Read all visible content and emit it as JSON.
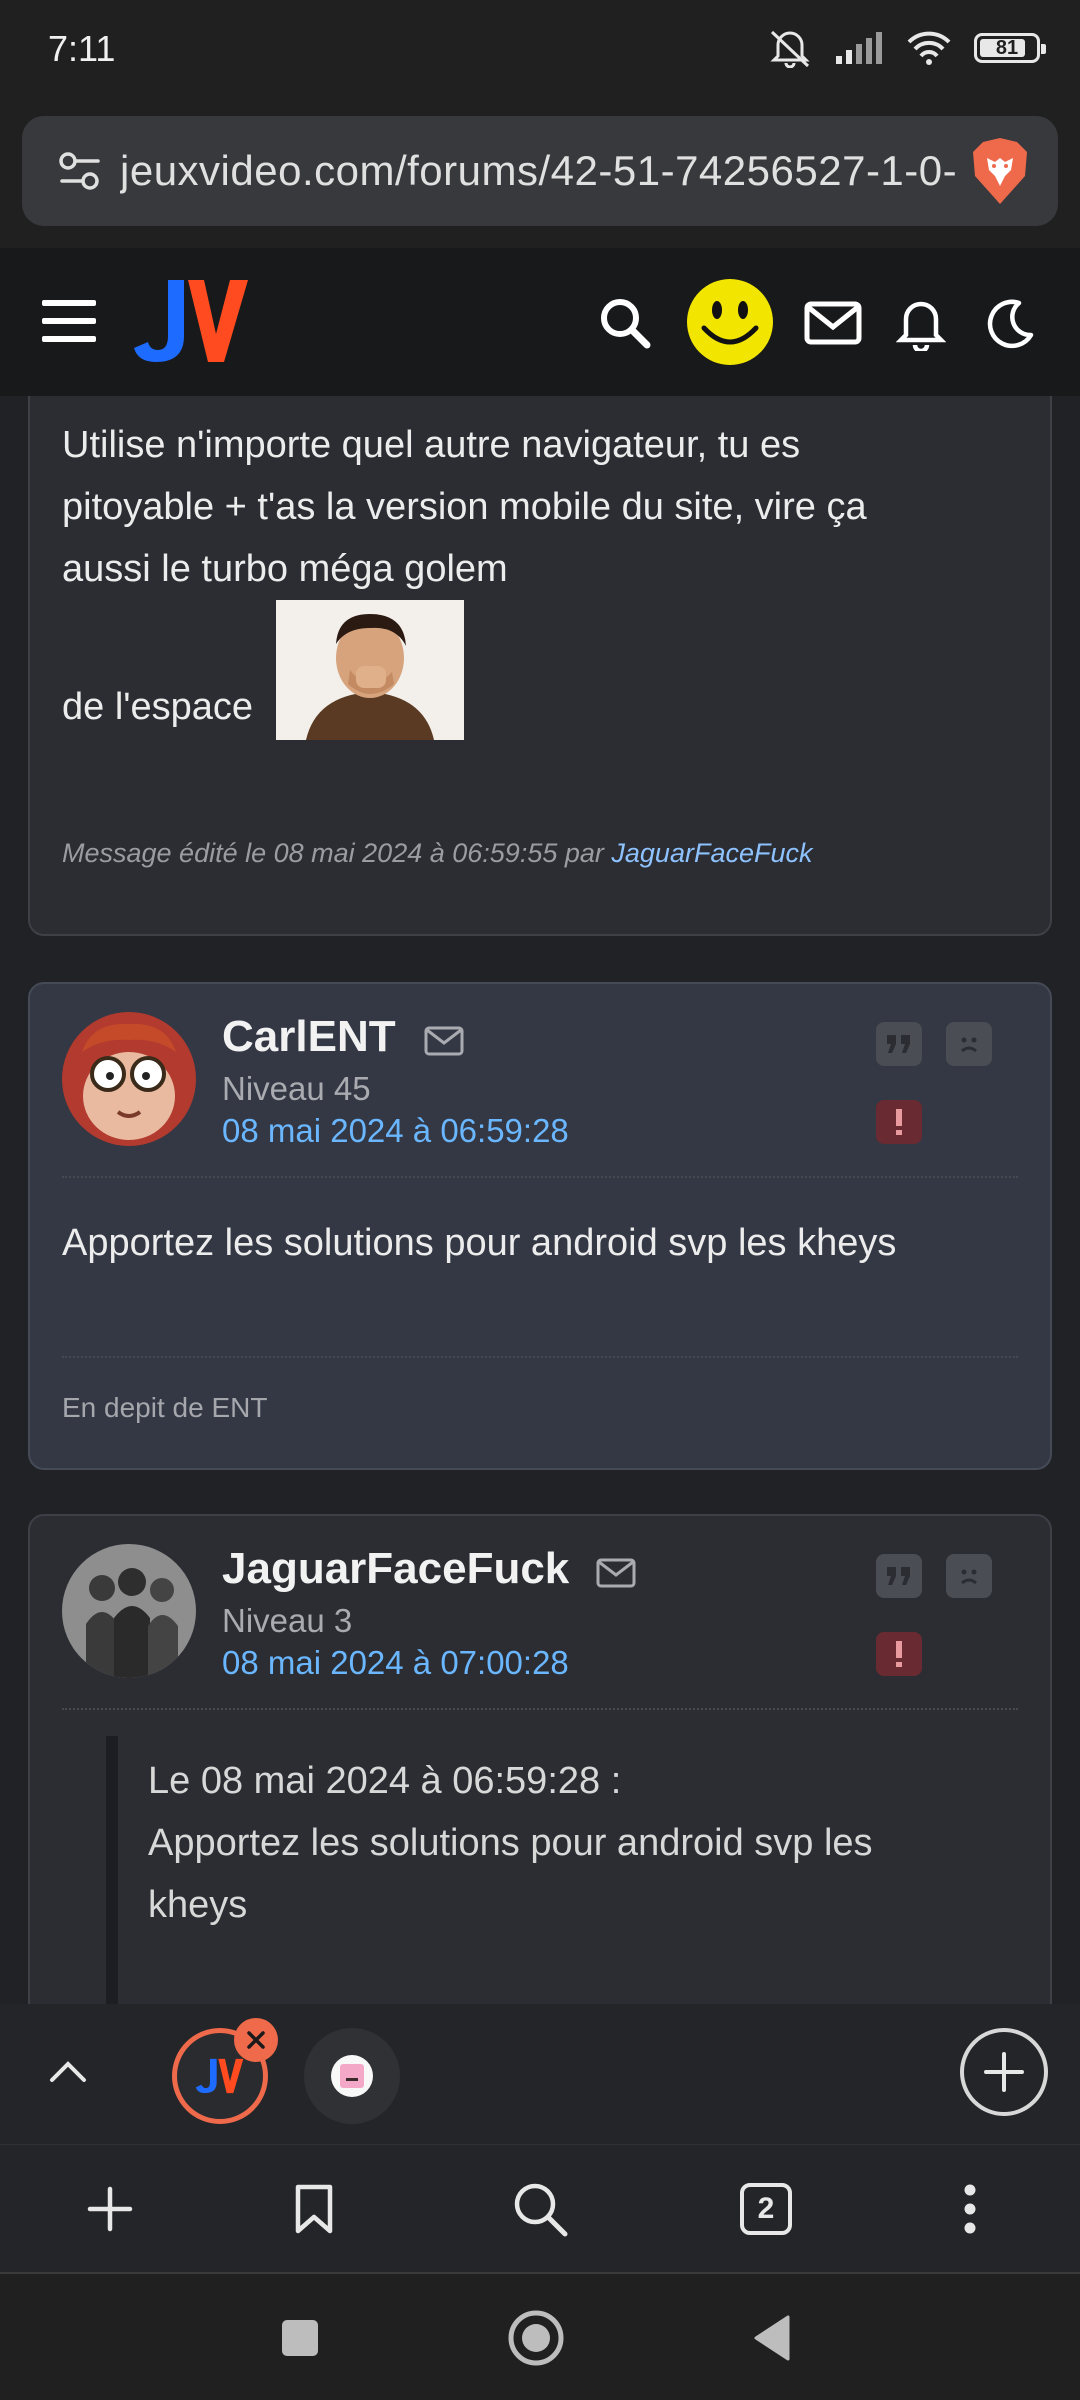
{
  "status_bar": {
    "time": "7:11",
    "battery": "81"
  },
  "browser": {
    "url": "jeuxvideo.com/forums/42-51-74256527-1-0-",
    "tab_count": "2"
  },
  "site": {
    "logo": "JV"
  },
  "posts": [
    {
      "text_line1": "Utilise n'importe quel autre navigateur, tu es",
      "text_line2": "pitoyable + t'as la version mobile du site, vire ça",
      "text_line3": "aussi le turbo méga golem",
      "text_line4": "de l'espace",
      "edited_prefix": "Message édité le 08 mai 2024 à 06:59:55 par",
      "edited_by": "JaguarFaceFuck"
    },
    {
      "author": "CarlENT",
      "level": "Niveau 45",
      "date": "08 mai 2024 à 06:59:28",
      "text": "Apportez les solutions pour android svp les kheys",
      "signature": "En depit de ENT"
    },
    {
      "author": "JaguarFaceFuck",
      "level": "Niveau 3",
      "date": "08 mai 2024 à 07:00:28",
      "quote_header": "Le 08 mai 2024 à 06:59:28 :",
      "quote_line1": "Apportez les solutions pour android svp les",
      "quote_line2": "kheys"
    }
  ],
  "colors": {
    "accent_link": "#6ab6ff",
    "brave_orange": "#ef6a4b",
    "jv_blue": "#1e6bff",
    "jv_orange": "#ff4b1f"
  }
}
